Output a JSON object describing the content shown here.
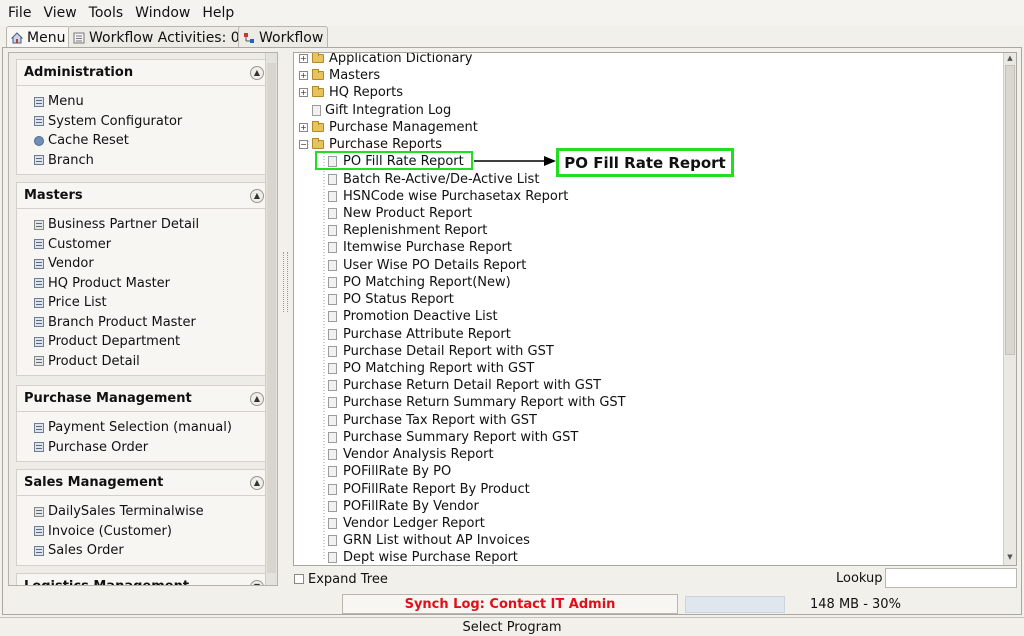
{
  "menubar": {
    "file": "File",
    "view": "View",
    "tools": "Tools",
    "window": "Window",
    "help": "Help"
  },
  "tabs": {
    "menu": "Menu",
    "workflow_activities": "Workflow Activities: 0",
    "workflow": "Workflow"
  },
  "sections": [
    {
      "title": "Administration",
      "items": [
        "Menu",
        "System Configurator",
        "Cache Reset",
        "Branch"
      ]
    },
    {
      "title": "Masters",
      "items": [
        "Business Partner Detail",
        "Customer",
        "Vendor",
        "HQ Product Master",
        "Price List",
        "Branch Product Master",
        "Product Department",
        "Product Detail"
      ]
    },
    {
      "title": "Purchase Management",
      "items": [
        "Payment Selection (manual)",
        "Purchase Order"
      ]
    },
    {
      "title": "Sales Management",
      "items": [
        "DailySales Terminalwise",
        "Invoice (Customer)",
        "Sales Order"
      ]
    },
    {
      "title": "Logistics Management",
      "items": []
    }
  ],
  "tree": {
    "folders": [
      "Application Dictionary",
      "Masters",
      "HQ Reports"
    ],
    "gift_log": "Gift Integration Log",
    "purchase_management": "Purchase Management",
    "purchase_reports": "Purchase Reports",
    "reports": [
      "PO Fill Rate Report",
      "Batch Re-Active/De-Active List",
      "HSNCode wise Purchasetax Report",
      "New Product Report",
      "Replenishment Report",
      "Itemwise Purchase Report",
      "User Wise PO Details Report",
      "PO Matching Report(New)",
      "PO Status Report",
      "Promotion Deactive List",
      "Purchase Attribute Report",
      "Purchase Detail Report with GST",
      "PO Matching Report with GST",
      "Purchase Return Detail Report with GST",
      "Purchase Return Summary Report with GST",
      "Purchase Tax Report with GST",
      "Purchase Summary Report with GST",
      "Vendor Analysis Report",
      "POFillRate By PO",
      "POFillRate Report By Product",
      "POFillRate By Vendor",
      "Vendor Ledger Report",
      "GRN List without AP Invoices",
      "Dept wise Purchase Report"
    ]
  },
  "callout": "PO Fill Rate Report",
  "expand_tree": "Expand Tree",
  "lookup": "Lookup",
  "synch_log": "Synch Log: Contact IT Admin",
  "memory": "148 MB - 30%",
  "status": "Select Program",
  "colors": {
    "highlight": "#22dd22",
    "alert": "#e0101a"
  }
}
